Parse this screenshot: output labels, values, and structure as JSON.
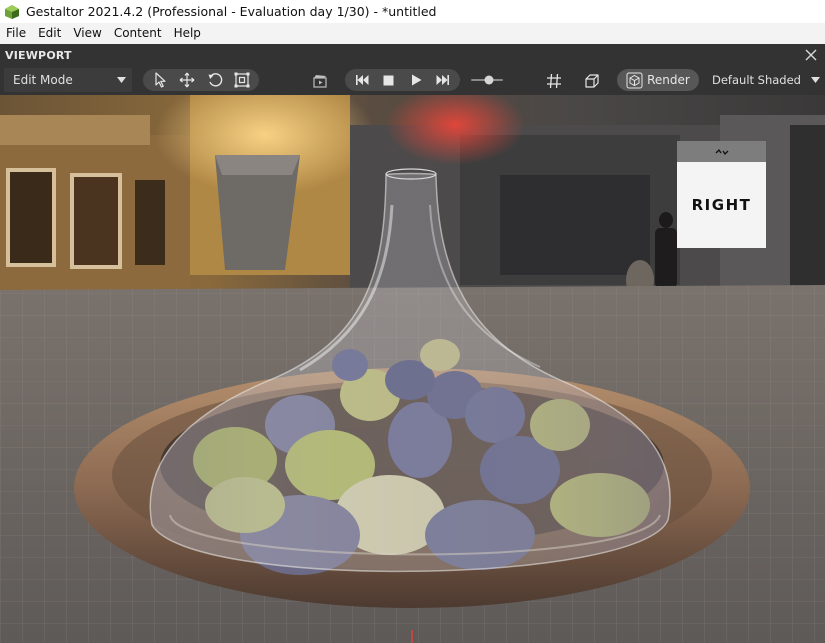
{
  "window": {
    "title": "Gestaltor 2021.4.2 (Professional - Evaluation day 1/30) - *untitled"
  },
  "menu": {
    "items": [
      "File",
      "Edit",
      "View",
      "Content",
      "Help"
    ]
  },
  "panel": {
    "title": "VIEWPORT"
  },
  "toolbar": {
    "mode": "Edit Mode",
    "render_label": "Render",
    "shading_mode": "Default Shaded"
  },
  "viewcube": {
    "face_label": "RIGHT"
  },
  "colors": {
    "toolbar_bg": "#333333",
    "title_bg": "#ffffff",
    "menu_bg": "#f3f3f3"
  }
}
